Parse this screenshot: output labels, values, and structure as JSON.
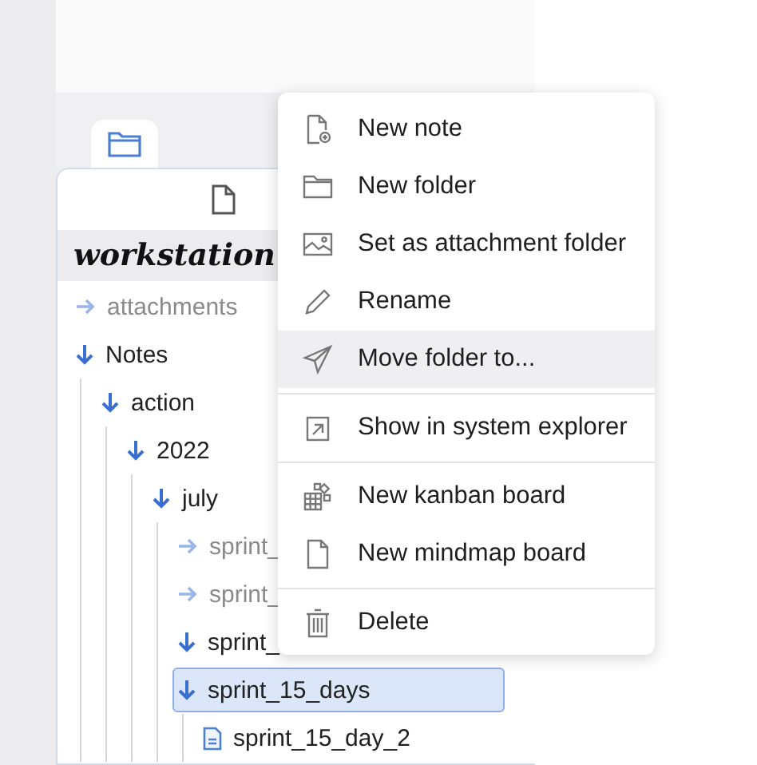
{
  "panel_tab": {
    "selected": true
  },
  "vault": {
    "title": "workstation"
  },
  "tree": [
    {
      "label": "attachments",
      "kind": "folder",
      "expanded": false,
      "selected": false
    },
    {
      "label": "Notes",
      "kind": "folder",
      "expanded": true,
      "selected": false,
      "children": [
        {
          "label": "action",
          "kind": "folder",
          "expanded": true,
          "selected": false,
          "children": [
            {
              "label": "2022",
              "kind": "folder",
              "expanded": true,
              "selected": false,
              "children": [
                {
                  "label": "july",
                  "kind": "folder",
                  "expanded": true,
                  "selected": false,
                  "children": [
                    {
                      "label": "sprint_",
                      "kind": "folder",
                      "expanded": false,
                      "selected": false
                    },
                    {
                      "label": "sprint_",
                      "kind": "folder",
                      "expanded": false,
                      "selected": false
                    },
                    {
                      "label": "sprint_",
                      "kind": "folder",
                      "expanded": true,
                      "selected": false
                    },
                    {
                      "label": "sprint_15_days",
                      "kind": "folder",
                      "expanded": true,
                      "selected": true,
                      "children": [
                        {
                          "label": "sprint_15_day_2",
                          "kind": "note",
                          "selected": false
                        }
                      ]
                    }
                  ]
                }
              ]
            }
          ]
        }
      ]
    }
  ],
  "context_menu": [
    [
      {
        "label": "New note",
        "hovered": false
      },
      {
        "label": "New folder",
        "hovered": false
      },
      {
        "label": "Set as attachment folder",
        "hovered": false
      },
      {
        "label": "Rename",
        "hovered": false
      },
      {
        "label": "Move folder to...",
        "hovered": true
      }
    ],
    [
      {
        "label": "Show in system explorer",
        "hovered": false
      }
    ],
    [
      {
        "label": "New kanban board",
        "hovered": false
      },
      {
        "label": "New mindmap board",
        "hovered": false
      }
    ],
    [
      {
        "label": "Delete",
        "hovered": false
      }
    ]
  ]
}
